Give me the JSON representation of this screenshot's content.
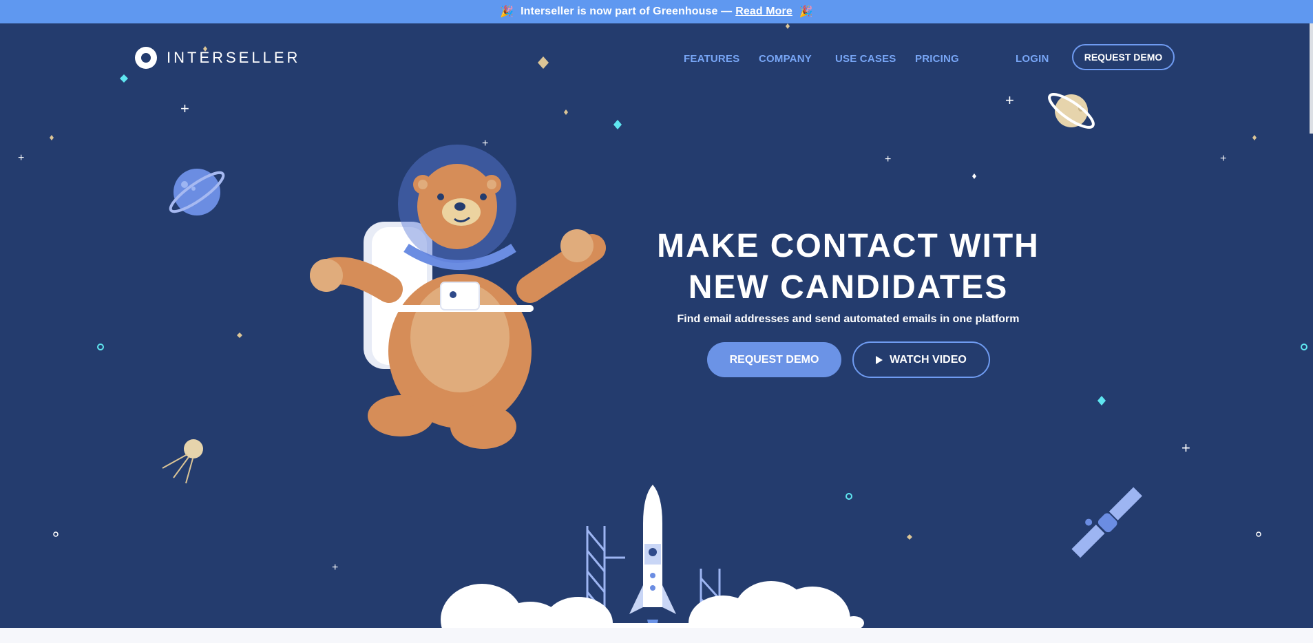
{
  "announcement": {
    "text": "Interseller is now part of Greenhouse —",
    "link": "Read More",
    "left_emoji": "🎉",
    "right_emoji": "🎉"
  },
  "header": {
    "logo_text": "INTERSELLER",
    "nav": [
      {
        "label": "FEATURES"
      },
      {
        "label": "COMPANY"
      },
      {
        "label": "USE CASES"
      },
      {
        "label": "PRICING"
      }
    ],
    "login": "LOGIN",
    "request_demo": "REQUEST DEMO"
  },
  "hero": {
    "title_line1": "MAKE CONTACT WITH",
    "title_line2": "NEW CANDIDATES",
    "subtitle": "Find email addresses and send automated emails in one platform",
    "primary_cta": "REQUEST DEMO",
    "secondary_cta": "WATCH VIDEO"
  },
  "colors": {
    "background": "#243c6e",
    "announce_bar": "#5f98f0",
    "accent": "#6b93e6",
    "nav_link": "#78a6f6"
  },
  "icons": [
    "logo-mark-icon",
    "party-popper-icon",
    "play-icon",
    "planet-icon",
    "ringed-planet-icon",
    "satellite-icon",
    "sputnik-icon",
    "rocket-icon",
    "bear-astronaut-illustration",
    "star-icon"
  ]
}
